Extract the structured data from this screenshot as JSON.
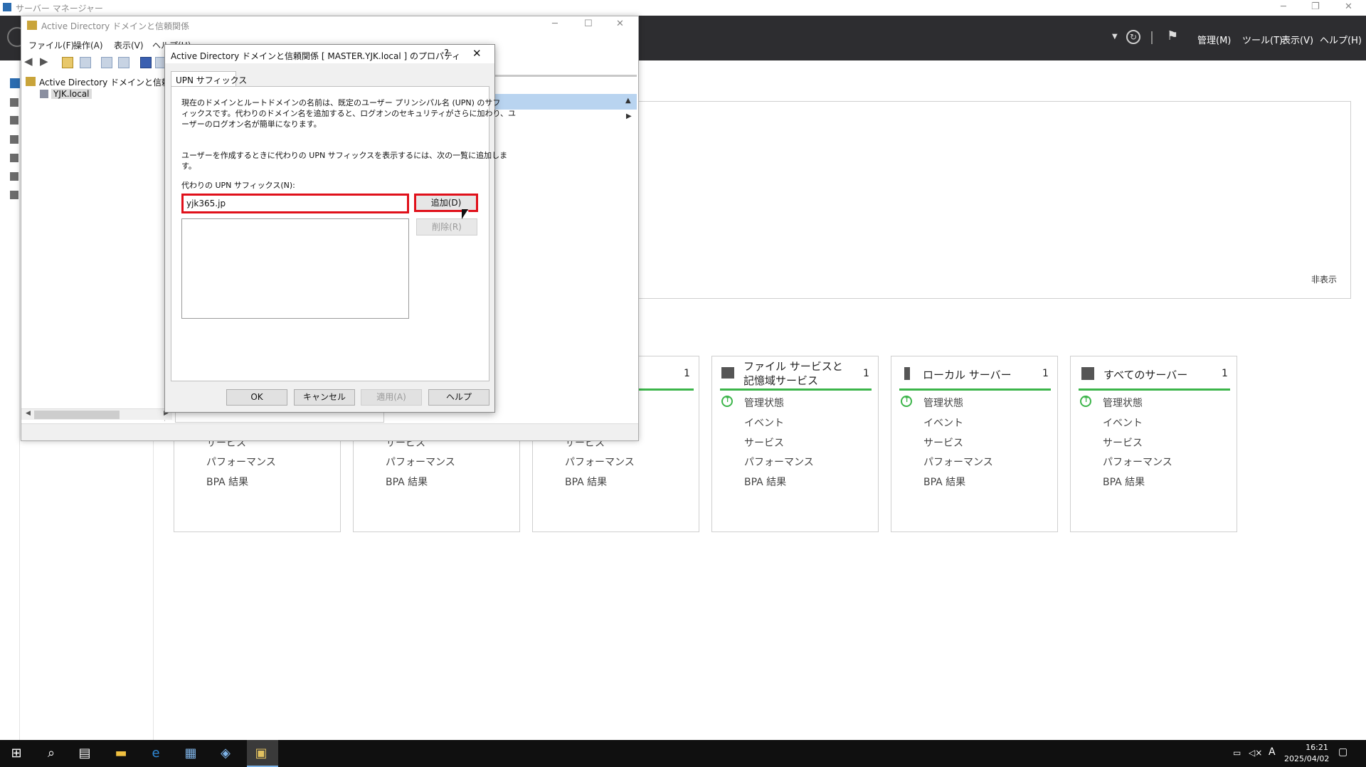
{
  "server_manager": {
    "title": "サーバー マネージャー",
    "header_menus": [
      "管理(M)",
      "ツール(T)",
      "表示(V)",
      "ヘルプ(H)"
    ],
    "hide_label": "非表示",
    "tiles": [
      {
        "title": "",
        "count": "",
        "items": [
          "サービス",
          "パフォーマンス",
          "BPA 結果"
        ]
      },
      {
        "title": "",
        "count": "",
        "items": [
          "サービス",
          "パフォーマンス",
          "BPA 結果"
        ]
      },
      {
        "title": "",
        "count": "1",
        "items": [
          "サービス",
          "パフォーマンス",
          "BPA 結果"
        ]
      },
      {
        "title": "ファイル サービスと記憶域サービス",
        "count": "1",
        "status": "管理状態",
        "items": [
          "イベント",
          "サービス",
          "パフォーマンス",
          "BPA 結果"
        ]
      },
      {
        "title": "ローカル サーバー",
        "count": "1",
        "status": "管理状態",
        "items": [
          "イベント",
          "サービス",
          "パフォーマンス",
          "BPA 結果"
        ]
      },
      {
        "title": "すべてのサーバー",
        "count": "1",
        "status": "管理状態",
        "items": [
          "イベント",
          "サービス",
          "パフォーマンス",
          "BPA 結果"
        ]
      }
    ]
  },
  "ad_window": {
    "title": "Active Directory ドメインと信頼関係",
    "menus": [
      "ファイル(F)",
      "操作(A)",
      "表示(V)",
      "ヘルプ(H)"
    ],
    "tree_root": "Active Directory ドメインと信頼関係",
    "tree_child": "YJK.local"
  },
  "dialog": {
    "title": "Active Directory ドメインと信頼関係 [ MASTER.YJK.local ] のプロパティ",
    "help_glyph": "?",
    "tab": "UPN サフィックス",
    "desc1_lines": [
      "現在のドメインとルートドメインの名前は、既定のユーザー プリンシパル名 (UPN) のサフ",
      "ィックスです。代わりのドメイン名を追加すると、ログオンのセキュリティがさらに加わり、ユ",
      "ーザーのログオン名が簡単になります。"
    ],
    "desc2_lines": [
      "ユーザーを作成するときに代わりの UPN サフィックスを表示するには、次の一覧に追加しま",
      "す。"
    ],
    "field_label": "代わりの UPN サフィックス(N):",
    "input_value": "yjk365.jp",
    "add_button": "追加(D)",
    "remove_button": "削除(R)",
    "ok_button": "OK",
    "cancel_button": "キャンセル",
    "apply_button": "適用(A)",
    "help_button": "ヘルプ"
  },
  "taskbar": {
    "time": "16:21",
    "date": "2025/04/02",
    "ime": "A"
  },
  "colors": {
    "highlight_red": "#e0101a",
    "status_green": "#3cb54a",
    "header_dark": "#2d2d30"
  }
}
